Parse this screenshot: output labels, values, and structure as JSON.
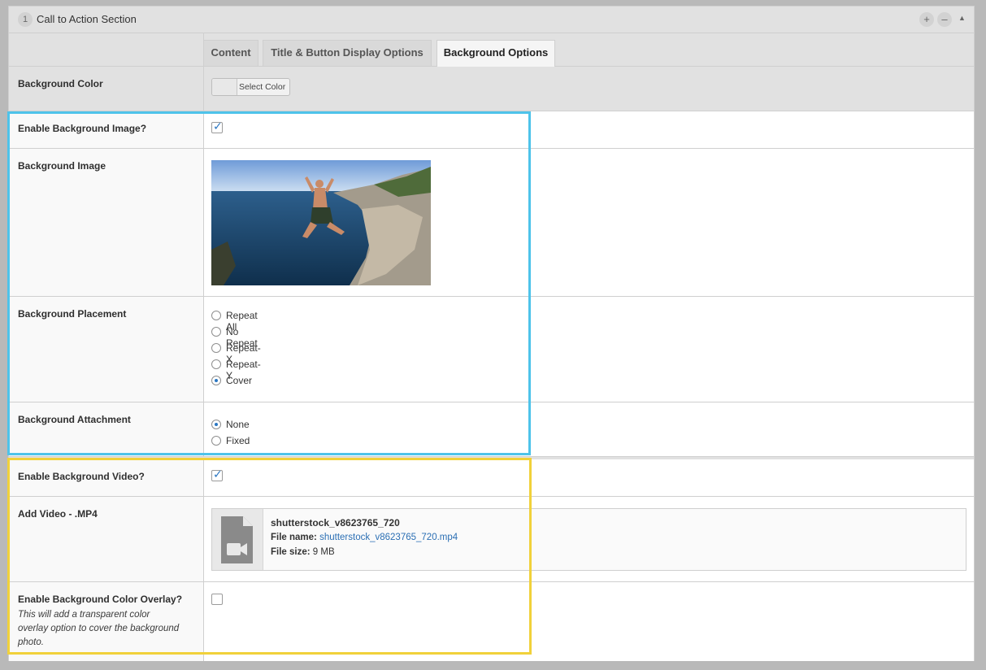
{
  "panel": {
    "number": "1",
    "title": "Call to Action Section",
    "controls": {
      "add": "+",
      "remove": "–",
      "collapse": "▲"
    }
  },
  "tabs": [
    {
      "label": "Content",
      "active": false
    },
    {
      "label": "Title & Button Display Options",
      "active": false
    },
    {
      "label": "Background Options",
      "active": true
    }
  ],
  "background_color": {
    "label": "Background Color",
    "button_label": "Select Color"
  },
  "enable_bg_image": {
    "label": "Enable Background Image?",
    "checked": true
  },
  "background_image": {
    "label": "Background Image"
  },
  "background_placement": {
    "label": "Background Placement",
    "options": [
      "Repeat All",
      "No Repeat",
      "Repeat-X",
      "Repeat-Y",
      "Cover"
    ],
    "selected": "Cover"
  },
  "background_attachment": {
    "label": "Background Attachment",
    "options": [
      "None",
      "Fixed"
    ],
    "selected": "None"
  },
  "enable_bg_video": {
    "label": "Enable Background Video?",
    "checked": true
  },
  "add_video": {
    "label": "Add Video - .MP4",
    "title": "shutterstock_v8623765_720",
    "file_name_label": "File name:",
    "file_name": "shutterstock_v8623765_720.mp4",
    "file_size_label": "File size:",
    "file_size": "9 MB"
  },
  "enable_overlay": {
    "label": "Enable Background Color Overlay?",
    "description": "This will add a transparent color overlay option to cover the background photo.",
    "checked": false
  },
  "colors": {
    "highlight_blue": "#4ec3ea",
    "highlight_yellow": "#f1d13a",
    "accent": "#2b77c2"
  }
}
